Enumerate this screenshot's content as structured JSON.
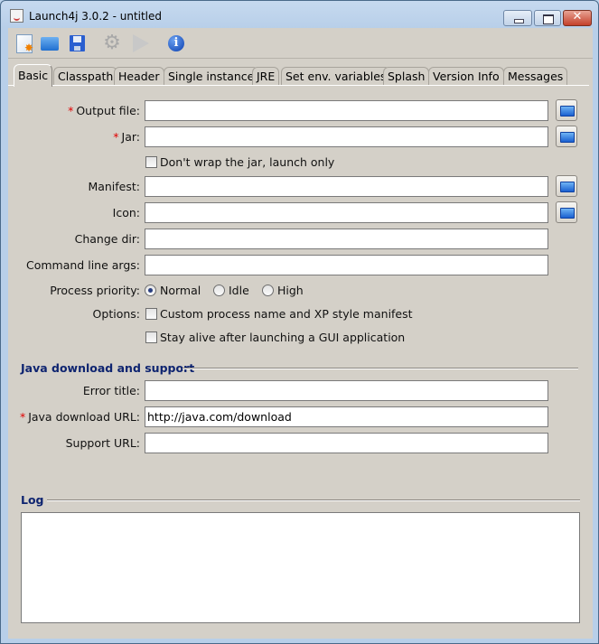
{
  "window": {
    "title": "Launch4j 3.0.2 - untitled",
    "controls": {
      "minimize": "minimize",
      "maximize": "maximize",
      "close": "✕"
    }
  },
  "toolbar": {
    "buttons": [
      {
        "name": "new-config",
        "icon": "new-document-icon"
      },
      {
        "name": "open-config",
        "icon": "folder-open-icon"
      },
      {
        "name": "save-config",
        "icon": "floppy-disk-icon"
      },
      {
        "name": "build-wrapper",
        "icon": "gear-icon",
        "glyph": "⚙"
      },
      {
        "name": "test-wrapper",
        "icon": "play-icon"
      },
      {
        "name": "about",
        "icon": "info-icon"
      }
    ]
  },
  "tabs": [
    {
      "label": "Basic",
      "active": true
    },
    {
      "label": "Classpath"
    },
    {
      "label": "Header"
    },
    {
      "label": "Single instance"
    },
    {
      "label": "JRE"
    },
    {
      "label": "Set env. variables"
    },
    {
      "label": "Splash"
    },
    {
      "label": "Version Info"
    },
    {
      "label": "Messages"
    }
  ],
  "basic": {
    "required_marker": "*",
    "output_file": {
      "label": "Output file:",
      "value": ""
    },
    "jar": {
      "label": "Jar:",
      "value": ""
    },
    "dont_wrap": {
      "label": "Don't wrap the jar, launch only",
      "checked": false
    },
    "manifest": {
      "label": "Manifest:",
      "value": ""
    },
    "icon": {
      "label": "Icon:",
      "value": ""
    },
    "change_dir": {
      "label": "Change dir:",
      "value": ""
    },
    "cmd_args": {
      "label": "Command line args:",
      "value": ""
    },
    "priority": {
      "label": "Process priority:",
      "options": [
        "Normal",
        "Idle",
        "High"
      ],
      "selected": "Normal"
    },
    "options": {
      "label": "Options:",
      "custom_process": {
        "label": "Custom process name and XP style manifest",
        "checked": false
      },
      "stay_alive": {
        "label": "Stay alive after launching a GUI application",
        "checked": false
      }
    }
  },
  "java_download": {
    "title": "Java download and support",
    "error_title": {
      "label": "Error title:",
      "value": ""
    },
    "download_url": {
      "label": "Java download URL:",
      "value": "http://java.com/download"
    },
    "support_url": {
      "label": "Support URL:",
      "value": ""
    }
  },
  "log": {
    "title": "Log",
    "content": ""
  }
}
